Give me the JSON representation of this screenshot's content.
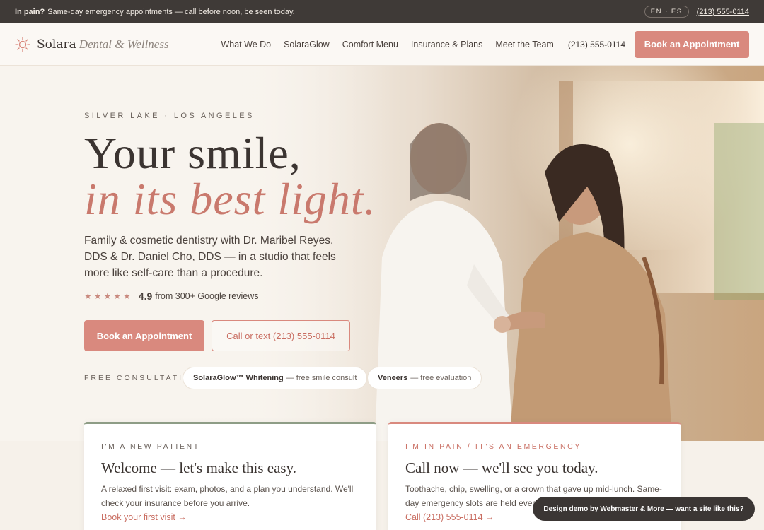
{
  "topbar": {
    "pain_strong": "In pain?",
    "pain_text": "Same-day emergency appointments — call before noon, be seen today.",
    "lang": "EN · ES",
    "phone": "(213) 555-0114"
  },
  "header": {
    "brand": "Solara",
    "brand_sub": "Dental & Wellness",
    "nav": [
      "What We Do",
      "SolaraGlow",
      "Comfort Menu",
      "Insurance & Plans",
      "Meet the Team"
    ],
    "phone": "(213) 555-0114",
    "book_label": "Book an Appointment"
  },
  "hero": {
    "eyebrow": "SILVER LAKE · LOS ANGELES",
    "headline_1": "Your smile,",
    "headline_2": "in its best light.",
    "lead": "Family & cosmetic dentistry with Dr. Maribel Reyes, DDS & Dr. Daniel Cho, DDS — in a studio that feels more like self-care than a procedure.",
    "stars": "★★★★★",
    "rating": {
      "score": 4.9,
      "text": "from 300+ Google reviews"
    },
    "cta_primary": "Book an Appointment",
    "cta_secondary": "Call or text (213) 555-0114",
    "free_label": "FREE CONSULTATIONS",
    "pills": [
      {
        "strong": "SolaraGlow™ Whitening",
        "rest": "— free smile consult"
      },
      {
        "strong": "Veneers",
        "rest": "— free evaluation"
      }
    ]
  },
  "cards": {
    "new_patient": {
      "tag": "I'M A NEW PATIENT",
      "title": "Welcome — let's make this easy.",
      "body": "A relaxed first visit: exam, photos, and a plan you understand. We'll check your insurance before you arrive.",
      "link": "Book your first visit →"
    },
    "emergency": {
      "tag": "I'M IN PAIN / IT'S AN EMERGENCY",
      "title": "Call now — we'll see you today.",
      "body": "Toothache, chip, swelling, or a crown that gave up mid-lunch. Same-day emergency slots are held every single day.",
      "link": "Call (213) 555-0114 →"
    }
  },
  "demo_badge": "Design demo by Webmaster & More — want a site like this?",
  "colors": {
    "accent": "#d9897e",
    "dark": "#3f3a37",
    "sage": "#8e9d86"
  },
  "icons": {
    "logo": "sun-icon",
    "rating": "star-icon"
  }
}
